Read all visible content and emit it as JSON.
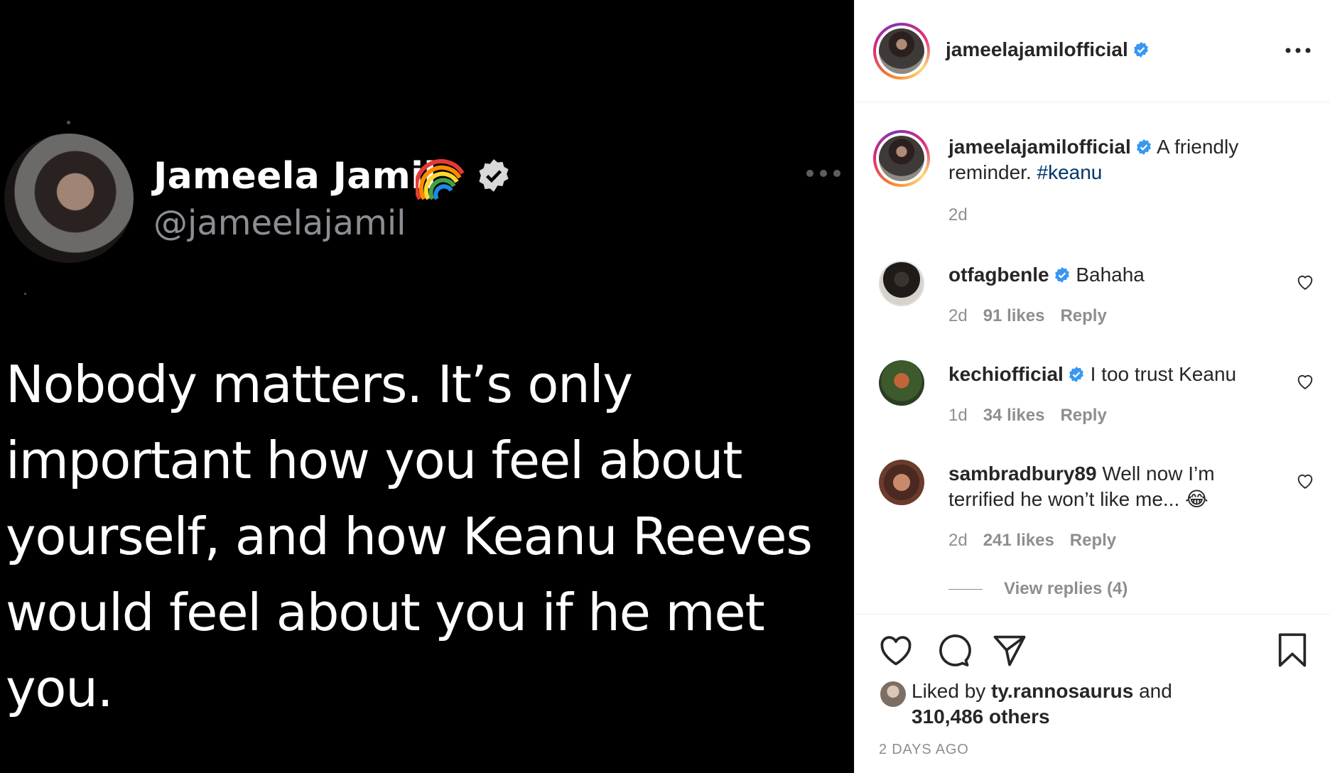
{
  "tweet": {
    "name": "Jameela Jamil",
    "handle": "@jameelajamil",
    "text": "Nobody matters. It’s only important how you feel about yourself, and how Keanu Reeves would feel about you if he met you."
  },
  "post": {
    "username": "jameelajamilofficial",
    "caption_text": "A friendly reminder.",
    "caption_hashtag": "#keanu",
    "caption_time": "2d",
    "liked_by_prefix": "Liked by",
    "liked_by_user": "ty.rannosaurus",
    "liked_by_and": "and",
    "likes_count": "310,486 others",
    "date": "2 DAYS AGO"
  },
  "comments": [
    {
      "username": "otfagbenle",
      "text": "Bahaha",
      "time": "2d",
      "likes": "91 likes",
      "reply": "Reply"
    },
    {
      "username": "kechiofficial",
      "text": "I too trust Keanu",
      "time": "1d",
      "likes": "34 likes",
      "reply": "Reply"
    },
    {
      "username": "sambradbury89",
      "text": "Well now I’m terrified he won’t like me... 😂",
      "time": "2d",
      "likes": "241 likes",
      "reply": "Reply"
    }
  ],
  "view_replies": "View replies (4)",
  "icons": {
    "more": "more-horizontal-icon",
    "verified": "verified-badge-icon",
    "like": "heart-icon",
    "comment": "comment-bubble-icon",
    "share": "paper-plane-icon",
    "save": "bookmark-icon"
  },
  "colors": {
    "verified_blue": "#3897f0",
    "hashtag": "#00376b",
    "meta_gray": "#8e8e8e"
  }
}
